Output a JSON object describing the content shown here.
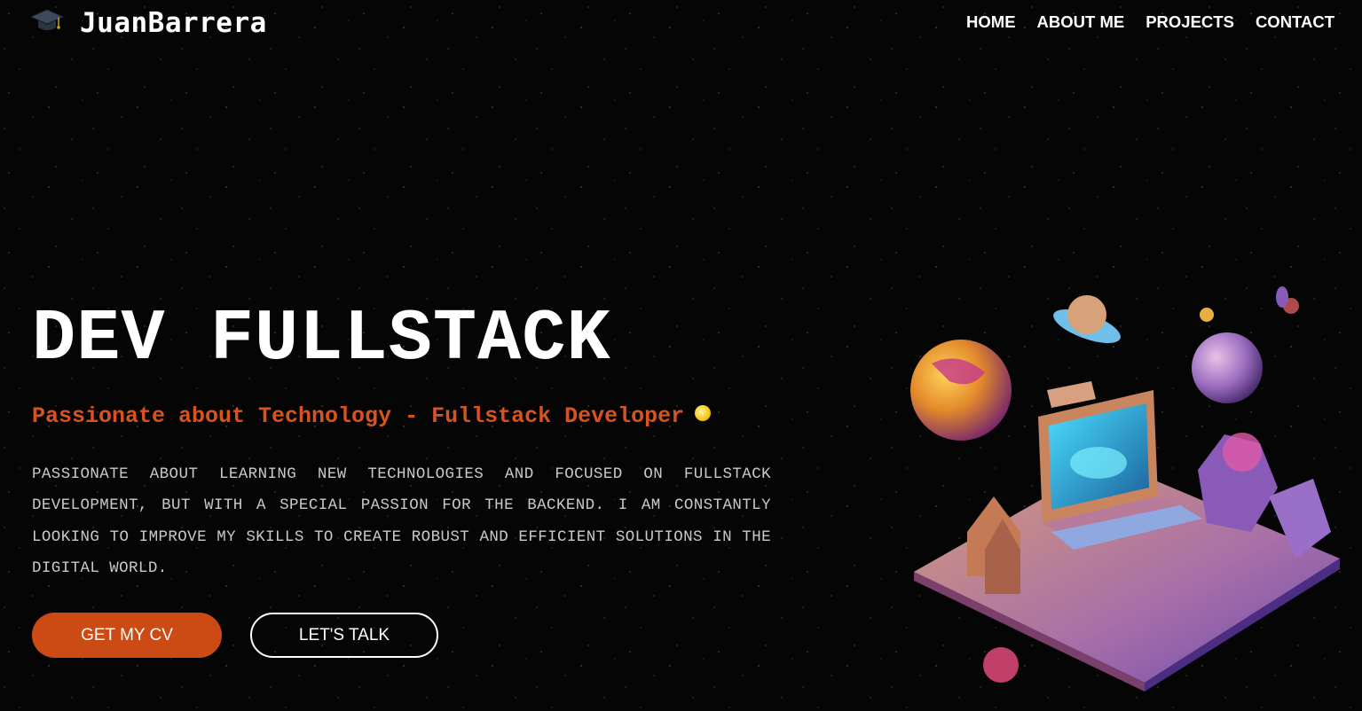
{
  "header": {
    "logo_icon": "graduation-cap-icon",
    "logo_text": "JuanBarrera",
    "nav": [
      {
        "label": "HOME"
      },
      {
        "label": "ABOUT ME"
      },
      {
        "label": "PROJECTS"
      },
      {
        "label": "CONTACT"
      }
    ]
  },
  "hero": {
    "title": "DEV FULLSTACK",
    "subtitle": "Passionate about Technology - Fullstack Developer",
    "subtitle_icon": "lightbulb-icon",
    "description": "PASSIONATE ABOUT LEARNING NEW TECHNOLOGIES AND FOCUSED ON FULLSTACK DEVELOPMENT, BUT WITH A SPECIAL PASSION FOR THE BACKEND. I AM CONSTANTLY LOOKING TO IMPROVE MY SKILLS TO CREATE ROBUST AND EFFICIENT SOLUTIONS IN THE DIGITAL WORLD.",
    "primary_button": "GET MY CV",
    "secondary_button": "LET'S TALK"
  },
  "colors": {
    "accent": "#cc4a14",
    "subtitle": "#d9531e",
    "background": "#050505",
    "text": "#ffffff"
  }
}
